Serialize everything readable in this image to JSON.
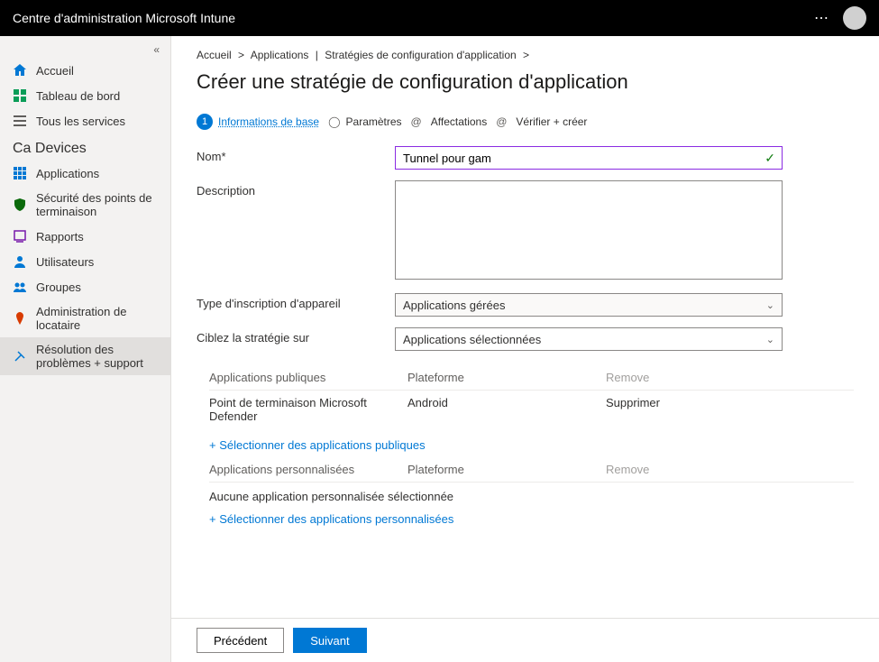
{
  "topbar": {
    "title": "Centre d'administration Microsoft Intune"
  },
  "sidebar": {
    "home": "Accueil",
    "dashboard": "Tableau de bord",
    "allservices": "Tous les services",
    "section": "Ca Devices",
    "apps": "Applications",
    "endpoint": "Sécurité des points de terminaison",
    "reports": "Rapports",
    "users": "Utilisateurs",
    "groups": "Groupes",
    "tenant": "Administration de locataire",
    "troubleshoot": "Résolution des problèmes + support"
  },
  "breadcrumb": {
    "home": "Accueil",
    "sep1": ">",
    "apps": "Applications",
    "pipe": "|",
    "policies": "Stratégies de configuration d'application",
    "sep2": ">"
  },
  "page": {
    "title": "Créer une stratégie de configuration d'application"
  },
  "steps": {
    "s1": "Informations de base",
    "s2": "Paramètres",
    "s3": "Affectations",
    "s4": "Vérifier + créer"
  },
  "form": {
    "name_label": "Nom*",
    "name_value": "Tunnel pour gam",
    "desc_label": "Description",
    "enroll_label": "Type d'inscription d'appareil",
    "enroll_value": "Applications gérées",
    "target_label": "Ciblez la stratégie sur",
    "target_value": "Applications sélectionnées"
  },
  "publicTable": {
    "h_app": "Applications publiques",
    "h_plat": "Plateforme",
    "h_remove": "Remove",
    "r_app": "Point de terminaison Microsoft Defender",
    "r_plat": "Android",
    "r_remove": "Supprimer",
    "add": "Sélectionner des applications publiques"
  },
  "customTable": {
    "h_app": "Applications personnalisées",
    "h_plat": "Plateforme",
    "h_remove": "Remove",
    "empty": "Aucune application personnalisée sélectionnée",
    "add": "Sélectionner des applications personnalisées"
  },
  "footer": {
    "prev": "Précédent",
    "next": "Suivant"
  }
}
